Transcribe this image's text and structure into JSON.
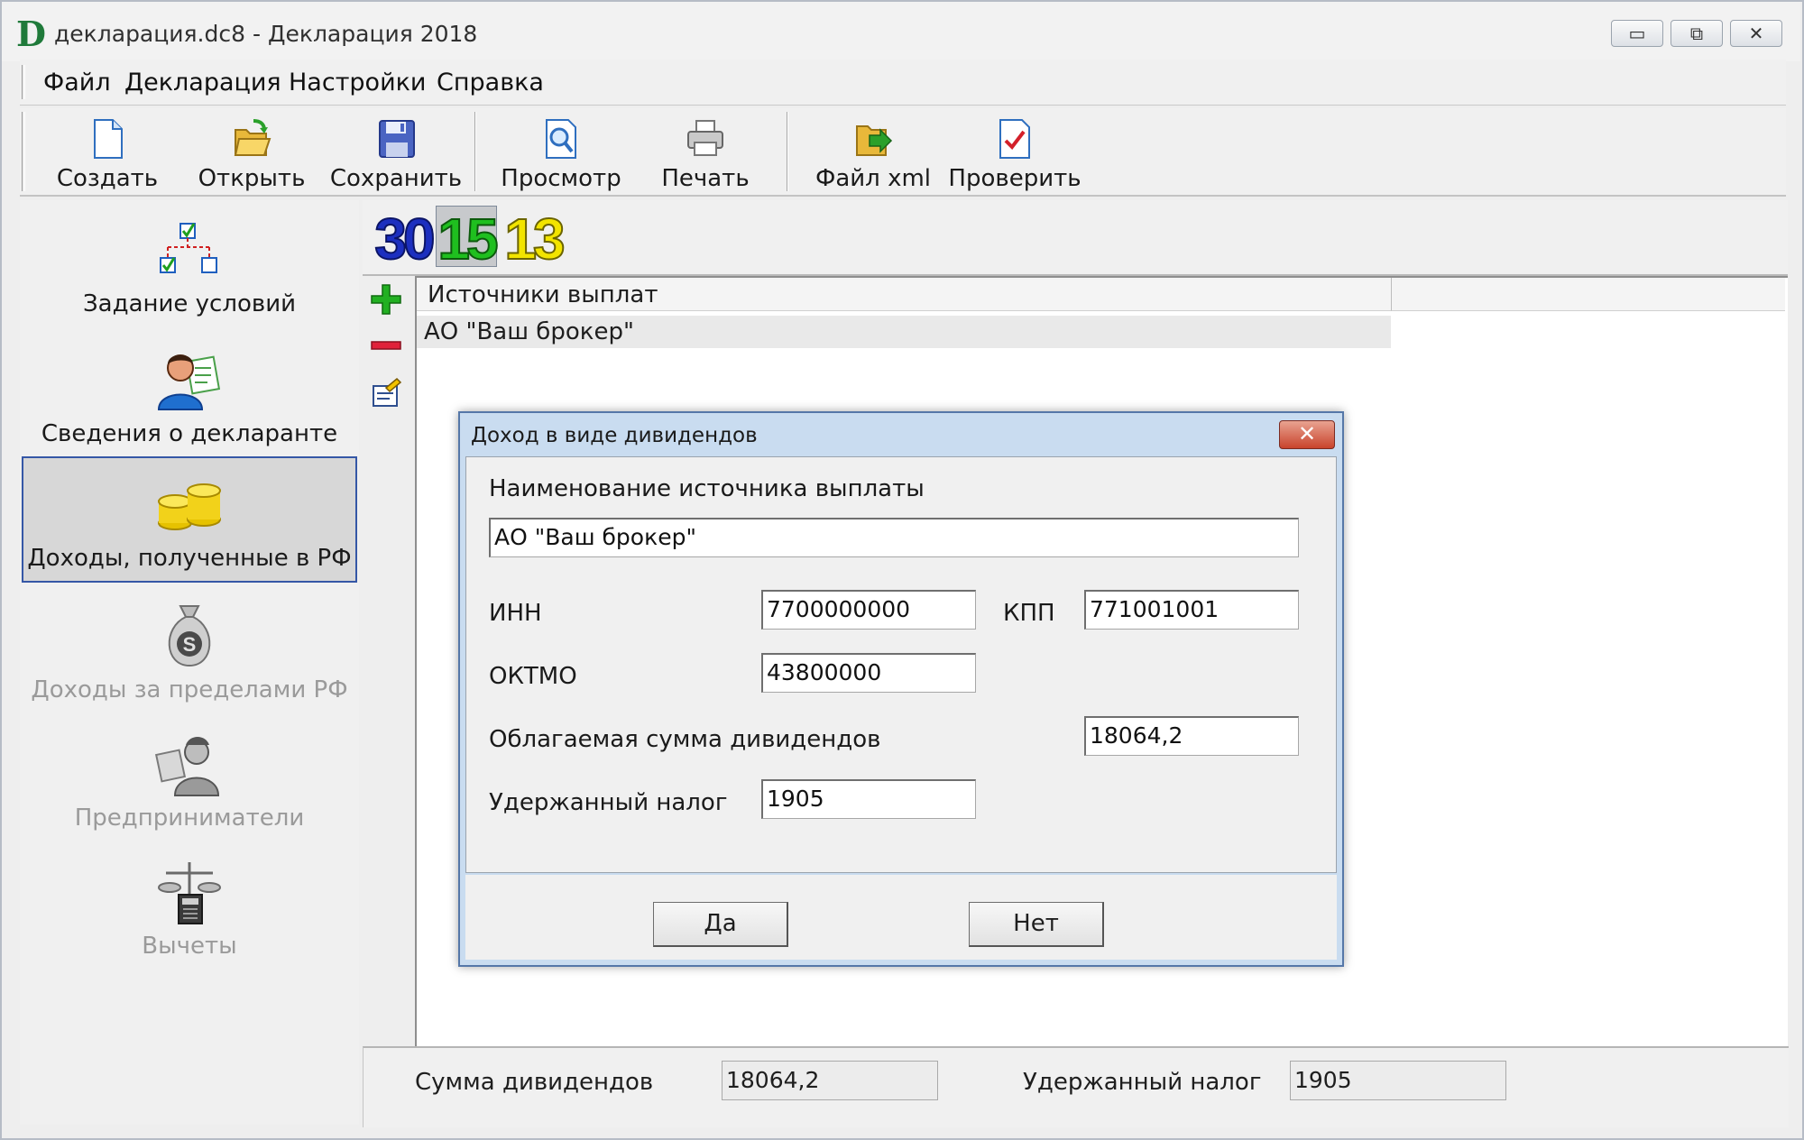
{
  "window": {
    "title": "декларация.dc8 - Декларация 2018",
    "logo_letter": "D",
    "controls": {
      "minimize": "▭",
      "maximize": "⧉",
      "close": "✕"
    }
  },
  "menu": [
    "Файл",
    "Декларация",
    "Настройки",
    "Справка"
  ],
  "toolbar": {
    "create": "Создать",
    "open": "Открыть",
    "save": "Сохранить",
    "preview": "Просмотр",
    "print": "Печать",
    "xml": "Файл xml",
    "check": "Проверить"
  },
  "nav": [
    {
      "label": "Задание условий",
      "icon": "conditions-tree-icon",
      "enabled": true
    },
    {
      "label": "Сведения о декларанте",
      "icon": "declarant-person-icon",
      "enabled": true
    },
    {
      "label": "Доходы, полученные в РФ",
      "icon": "gold-coins-icon",
      "enabled": true,
      "selected": true
    },
    {
      "label": "Доходы за пределами РФ",
      "icon": "money-bag-icon",
      "enabled": false
    },
    {
      "label": "Предприниматели",
      "icon": "entrepreneur-icon",
      "enabled": false
    },
    {
      "label": "Вычеты",
      "icon": "scales-calculator-icon",
      "enabled": false
    }
  ],
  "rates": [
    {
      "value": "30",
      "color": "#1c2fbf"
    },
    {
      "value": "15",
      "color": "#1fbf1f",
      "selected": true
    },
    {
      "value": "13",
      "color": "#f2e400"
    }
  ],
  "list": {
    "header": "Источники выплат",
    "rows": [
      "АО \"Ваш брокер\""
    ]
  },
  "dialog": {
    "title": "Доход в виде дивидендов",
    "close": "✕",
    "source_name_label": "Наименование источника выплаты",
    "source_name_value": "АО \"Ваш брокер\"",
    "inn_label": "ИНН",
    "inn_value": "7700000000",
    "kpp_label": "КПП",
    "kpp_value": "771001001",
    "oktmo_label": "ОКТМО",
    "oktmo_value": "43800000",
    "taxable_label": "Облагаемая сумма дивидендов",
    "taxable_value": "18064,2",
    "withheld_label": "Удержанный налог",
    "withheld_value": "1905",
    "ok": "Да",
    "cancel": "Нет"
  },
  "footer": {
    "sum_label": "Сумма дивидендов",
    "sum_value": "18064,2",
    "tax_label": "Удержанный налог",
    "tax_value": "1905"
  },
  "colors": {
    "accent_selected_border": "#3557a6",
    "dialog_frame": "#c9dcf0",
    "close_button": "#c8432c"
  }
}
